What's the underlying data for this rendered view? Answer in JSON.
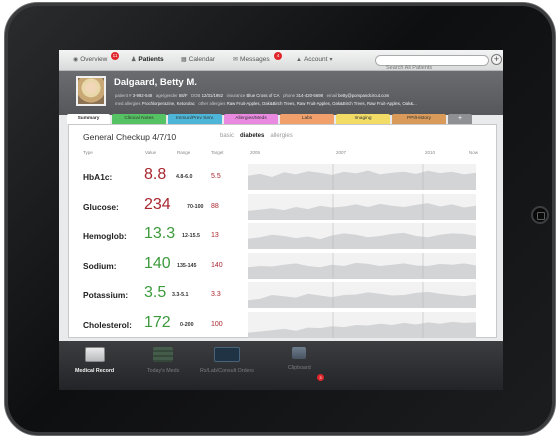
{
  "nav": {
    "items": [
      {
        "label": "Overview",
        "icon": "home-icon",
        "badge": "11"
      },
      {
        "label": "Patients",
        "icon": "person-icon",
        "badge": ""
      },
      {
        "label": "Calendar",
        "icon": "calendar-icon",
        "badge": ""
      },
      {
        "label": "Messages",
        "icon": "envelope-icon",
        "badge": "4"
      },
      {
        "label": "Account",
        "icon": "lock-icon",
        "badge": ""
      }
    ],
    "search_placeholder": "Search All Patients",
    "add_label": "+"
  },
  "patient": {
    "name": "Dalgaard, Betty M.",
    "line1": {
      "patient_label": "patient #",
      "patient_id": "3-992-548",
      "age_label": "age/gender",
      "age": "58/F",
      "dob_label": "DOB",
      "dob": "12/31/1952",
      "insurance_label": "insurance",
      "insurance": "Blue Cross of CA",
      "phone_label": "phone",
      "phone": "314-420-5698",
      "email_label": "email",
      "email": "betty@pompandcircut.com"
    },
    "line2": {
      "med_label": "med allergies",
      "med": "Prochlorperazine, Ketorolac",
      "other_label": "other allergies",
      "other": "Raw Fruit-Apples, Oak&Birch Trees, Raw Fruit-Apples, Oak&Birch Trees, Raw Fruit-Apples, Oak&..."
    }
  },
  "tabs": [
    {
      "label": "Summary",
      "color": "#ffffff",
      "active": true
    },
    {
      "label": "Clinical Notes",
      "color": "#55c263"
    },
    {
      "label": "Immun/Prev Serv.",
      "color": "#4db6d8"
    },
    {
      "label": "Allergies/Meds",
      "color": "#e98ae0"
    },
    {
      "label": "Labs",
      "color": "#f2a06b"
    },
    {
      "label": "Imaging",
      "color": "#f3dc66"
    },
    {
      "label": "PPI/History",
      "color": "#d99a5a"
    },
    {
      "label": "+",
      "color": "#8f9093"
    }
  ],
  "summary": {
    "title": "General Checkup  4/7/10",
    "filters": [
      "basic",
      "diabetes",
      "allergies"
    ],
    "active_filter": "diabetes",
    "columns": {
      "type": "Type",
      "value": "Value",
      "range": "Range",
      "target": "Target"
    },
    "years": [
      "2005",
      "2007",
      "2010",
      "Now"
    ],
    "rows": [
      {
        "label": "HbA1c:",
        "value": "8.8",
        "range": "4.8-6.0",
        "target": "5.5",
        "status": "high",
        "trend": [
          0.55,
          0.62,
          0.5,
          0.68,
          0.6,
          0.72,
          0.66,
          0.58,
          0.7,
          0.64,
          0.75,
          0.6,
          0.66,
          0.7,
          0.62,
          0.74,
          0.65,
          0.7,
          0.6,
          0.66
        ]
      },
      {
        "label": "Glucose:",
        "value": "234",
        "range": "70-100",
        "target": "88",
        "status": "high",
        "trend": [
          0.35,
          0.4,
          0.45,
          0.38,
          0.5,
          0.42,
          0.55,
          0.48,
          0.52,
          0.6,
          0.5,
          0.62,
          0.55,
          0.5,
          0.58,
          0.65,
          0.52,
          0.6,
          0.48,
          0.55
        ]
      },
      {
        "label": "Hemoglob:",
        "value": "13.3",
        "range": "12-15.5",
        "target": "13",
        "status": "normal",
        "trend": [
          0.4,
          0.45,
          0.55,
          0.5,
          0.42,
          0.48,
          0.38,
          0.52,
          0.6,
          0.55,
          0.45,
          0.5,
          0.58,
          0.62,
          0.5,
          0.45,
          0.55,
          0.6,
          0.58,
          0.5
        ]
      },
      {
        "label": "Sodium:",
        "value": "140",
        "range": "135-145",
        "target": "140",
        "status": "normal",
        "trend": [
          0.45,
          0.5,
          0.48,
          0.55,
          0.6,
          0.5,
          0.45,
          0.55,
          0.5,
          0.62,
          0.58,
          0.5,
          0.55,
          0.6,
          0.52,
          0.5,
          0.58,
          0.55,
          0.6,
          0.52
        ]
      },
      {
        "label": "Potassium:",
        "value": "3.5",
        "range": "3.3-5.1",
        "target": "3.3",
        "status": "normal",
        "trend": [
          0.3,
          0.35,
          0.5,
          0.45,
          0.4,
          0.55,
          0.48,
          0.42,
          0.5,
          0.52,
          0.6,
          0.55,
          0.48,
          0.5,
          0.58,
          0.62,
          0.55,
          0.5,
          0.45,
          0.52
        ]
      },
      {
        "label": "Cholesterol:",
        "value": "172",
        "range": "0-200",
        "target": "100",
        "status": "normal",
        "trend": [
          0.2,
          0.25,
          0.3,
          0.35,
          0.28,
          0.4,
          0.38,
          0.45,
          0.42,
          0.5,
          0.48,
          0.55,
          0.5,
          0.58,
          0.52,
          0.6,
          0.55,
          0.62,
          0.58,
          0.6
        ]
      }
    ]
  },
  "colors": {
    "high": "#a8262f",
    "normal": "#3c9a3c",
    "target": "#a8262f"
  },
  "dock": [
    {
      "label": "Medical Record",
      "icon": "medical-record-icon",
      "active": true
    },
    {
      "label": "Today's Meds",
      "icon": "meds-icon",
      "active": false
    },
    {
      "label": "Rx/Lab/Consult Orders",
      "icon": "orders-icon",
      "active": false
    },
    {
      "label": "Clipboard",
      "icon": "clipboard-icon",
      "active": false,
      "badge": "3"
    }
  ]
}
